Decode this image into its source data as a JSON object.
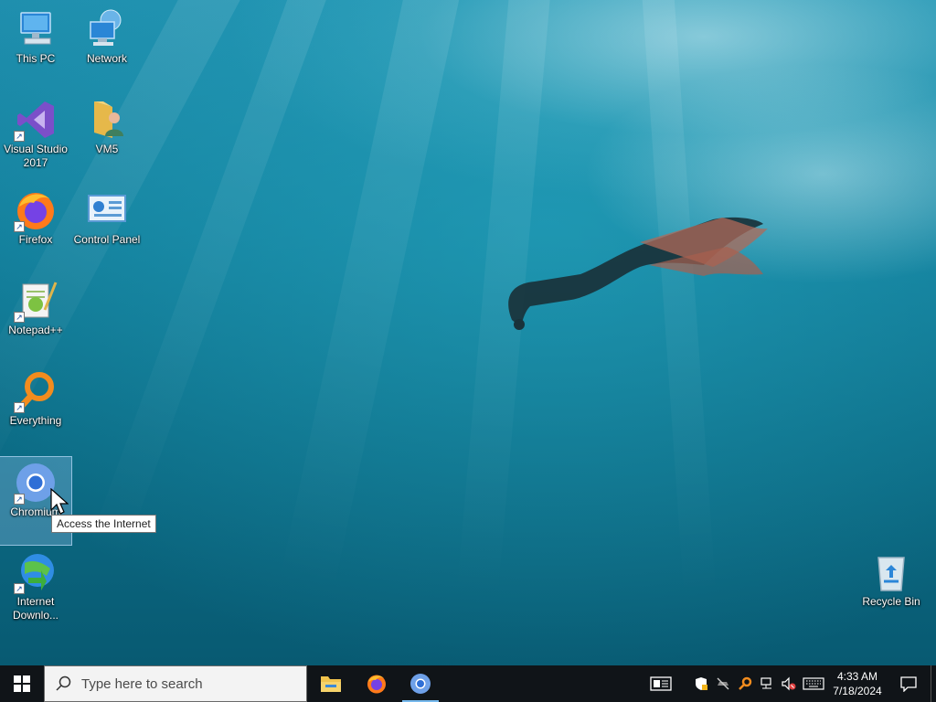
{
  "desktop": {
    "icons": [
      {
        "label": "This PC",
        "icon": "computer-icon"
      },
      {
        "label": "Network",
        "icon": "network-icon"
      },
      {
        "label": "Visual Studio 2017",
        "icon": "visual-studio-icon"
      },
      {
        "label": "VM5",
        "icon": "user-folder-icon"
      },
      {
        "label": "Firefox",
        "icon": "firefox-icon"
      },
      {
        "label": "Control Panel",
        "icon": "control-panel-icon"
      },
      {
        "label": "Notepad++",
        "icon": "notepad-plus-plus-icon"
      },
      {
        "label": "Everything",
        "icon": "everything-search-icon"
      },
      {
        "label": "Chromium",
        "icon": "chromium-icon"
      },
      {
        "label": "Internet Downlo...",
        "icon": "internet-download-manager-icon"
      },
      {
        "label": "Recycle Bin",
        "icon": "recycle-bin-icon"
      }
    ],
    "tooltip": "Access the Internet"
  },
  "taskbar": {
    "search_placeholder": "Type here to search",
    "pinned_apps": [
      "File Explorer",
      "Firefox",
      "Chromium"
    ],
    "tray_icons": [
      "news-icon",
      "security-icon",
      "network-off-icon",
      "search-everything-icon",
      "network-icon",
      "volume-muted-icon",
      "keyboard-icon"
    ],
    "time": "4:33 AM",
    "date": "7/18/2024"
  },
  "colors": {
    "taskbar_bg": "#101418",
    "selection": "#8cbee6",
    "active_indicator": "#76b9ed"
  }
}
